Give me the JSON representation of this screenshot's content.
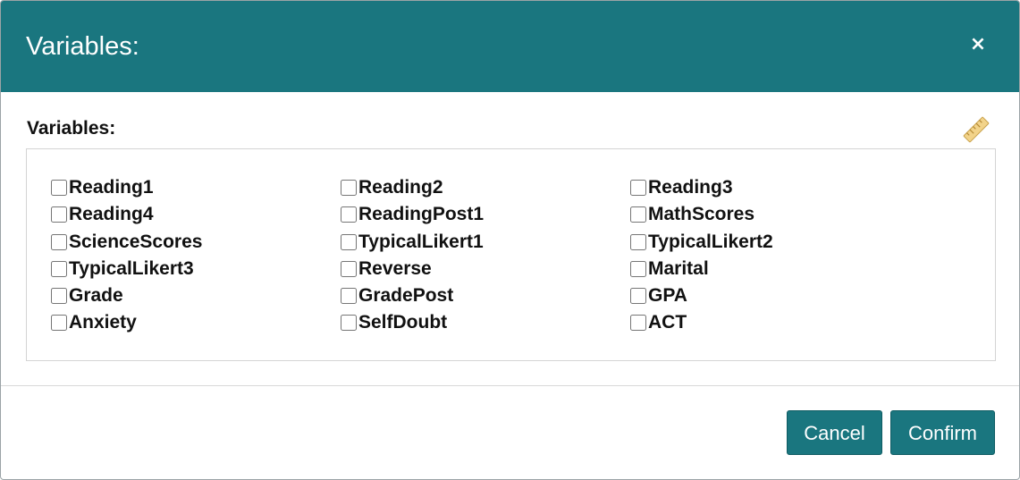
{
  "dialog": {
    "title": "Variables:",
    "close_glyph": "×",
    "header_color": "#1a767f"
  },
  "variables_section": {
    "label": "Variables:",
    "edit_icon": "ruler-icon",
    "items": [
      {
        "label": "Reading1",
        "checked": false
      },
      {
        "label": "Reading2",
        "checked": false
      },
      {
        "label": "Reading3",
        "checked": false
      },
      {
        "label": "Reading4",
        "checked": false
      },
      {
        "label": "ReadingPost1",
        "checked": false
      },
      {
        "label": "MathScores",
        "checked": false
      },
      {
        "label": "ScienceScores",
        "checked": false
      },
      {
        "label": "TypicalLikert1",
        "checked": false
      },
      {
        "label": "TypicalLikert2",
        "checked": false
      },
      {
        "label": "TypicalLikert3",
        "checked": false
      },
      {
        "label": "Reverse",
        "checked": false
      },
      {
        "label": "Marital",
        "checked": false
      },
      {
        "label": "Grade",
        "checked": false
      },
      {
        "label": "GradePost",
        "checked": false
      },
      {
        "label": "GPA",
        "checked": false
      },
      {
        "label": "Anxiety",
        "checked": false
      },
      {
        "label": "SelfDoubt",
        "checked": false
      },
      {
        "label": "ACT",
        "checked": false
      }
    ]
  },
  "footer": {
    "cancel_label": "Cancel",
    "confirm_label": "Confirm"
  }
}
